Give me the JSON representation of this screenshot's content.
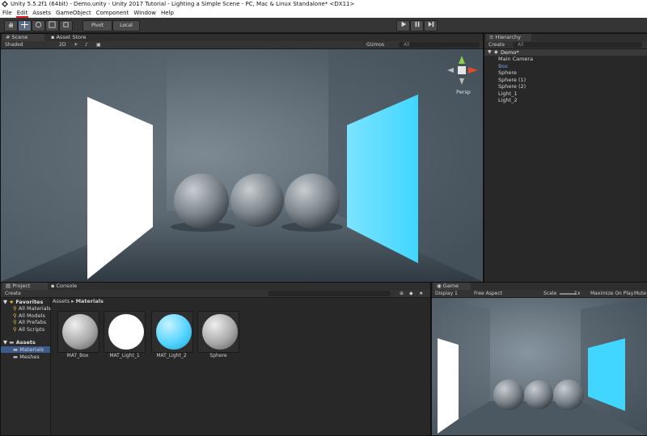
{
  "window": {
    "title": "Unity 5.5.2f1 (64bit) - Demo.unity - Unity 2017 Tutorial - Lighting a Simple Scene - PC, Mac & Linux Standalone* <DX11>"
  },
  "menu": [
    "File",
    "Edit",
    "Assets",
    "GameObject",
    "Component",
    "Window",
    "Help"
  ],
  "toolbar": {
    "pivot": "Pivot",
    "local": "Local"
  },
  "scene_panel": {
    "tabs": [
      "Scene",
      "Asset Store"
    ],
    "shading": "Shaded",
    "mode_2d": "2D",
    "gizmos": "Gizmos",
    "search_placeholder": "All",
    "persp_label": "Persp"
  },
  "hierarchy": {
    "tab": "Hierarchy",
    "create": "Create",
    "search_placeholder": "All",
    "scene_name": "Demo*",
    "items": [
      "Main Camera",
      "Box",
      "Sphere",
      "Sphere (1)",
      "Sphere (2)",
      "Light_1",
      "Light_2"
    ],
    "selected_index": 1
  },
  "project": {
    "tabs": [
      "Project",
      "Console"
    ],
    "create": "Create",
    "favorites_title": "Favorites",
    "favorites": [
      "All Materials",
      "All Models",
      "All Prefabs",
      "All Scripts"
    ],
    "assets_title": "Assets",
    "assets_children": [
      "Materials",
      "Meshes"
    ],
    "breadcrumb_root": "Assets",
    "breadcrumb_current": "Materials",
    "items": [
      {
        "name": "MAT_Box",
        "color": "#b8b8b8"
      },
      {
        "name": "MAT_Light_1",
        "color": "#ffffff"
      },
      {
        "name": "MAT_Light_2",
        "color": "#4fd0ff"
      },
      {
        "name": "Sphere",
        "color": "#b8b8b8"
      }
    ]
  },
  "game_panel": {
    "tab": "Game",
    "display": "Display 1",
    "aspect": "Free Aspect",
    "scale_label": "Scale",
    "scale_value": "1x",
    "maximize": "Maximize On Play",
    "mute": "Mute"
  },
  "colors": {
    "accent_cyan": "#41d6ff",
    "selection_blue": "#5d7fc2",
    "scene_bg": "#5f6a73"
  }
}
